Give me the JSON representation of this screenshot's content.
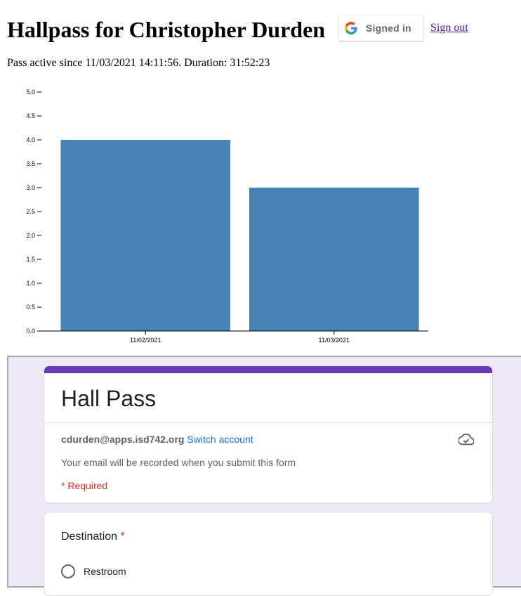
{
  "page": {
    "title": "Hallpass for Christopher Durden",
    "pass_status": "Pass active since 11/03/2021 14:11:56. Duration: 31:52:23",
    "signin_label": "Signed in",
    "signout_label": "Sign out"
  },
  "chart_data": {
    "type": "bar",
    "categories": [
      "11/02/2021",
      "11/03/2021"
    ],
    "values": [
      4,
      3
    ],
    "title": "",
    "xlabel": "",
    "ylabel": "",
    "ylim": [
      0,
      5
    ],
    "yticks": [
      "0.0",
      "0.5",
      "1.0",
      "1.5",
      "2.0",
      "2.5",
      "3.0",
      "3.5",
      "4.0",
      "4.5",
      "5.0"
    ],
    "bar_color": "#4682b4",
    "grid": false
  },
  "form": {
    "title": "Hall Pass",
    "account_email": "cdurden@apps.isd742.org",
    "switch_account": "Switch account",
    "email_note": "Your email will be recorded when you submit this form",
    "required_note": "* Required",
    "accent_color": "#673ab7",
    "background_color": "#ede7f6",
    "question": {
      "title": "Destination",
      "required_mark": "*",
      "options": [
        "Restroom"
      ]
    },
    "icons": {
      "cloud": "cloud-saved-icon",
      "google": "google-logo-icon"
    }
  }
}
